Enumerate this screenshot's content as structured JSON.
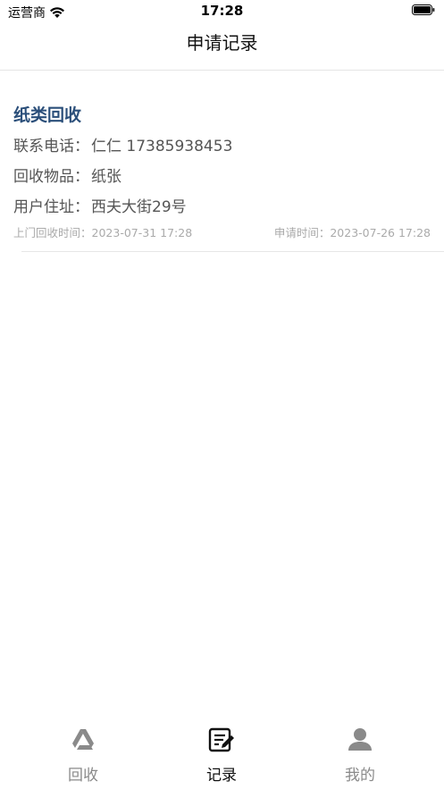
{
  "status_bar": {
    "carrier": "运营商",
    "time": "17:28"
  },
  "nav": {
    "title": "申请记录"
  },
  "records": [
    {
      "category": "纸类回收",
      "phone_label": "联系电话：",
      "phone_value": "仁仁  17385938453",
      "item_label": "回收物品：",
      "item_value": "纸张",
      "address_label": "用户住址：",
      "address_value": "西夫大街29号",
      "pickup_label": "上门回收时间：",
      "pickup_time": "2023-07-31 17:28",
      "apply_label": "申请时间：",
      "apply_time": "2023-07-26 17:28"
    }
  ],
  "tabs": [
    {
      "label": "回收",
      "icon": "recycle-icon",
      "active": false
    },
    {
      "label": "记录",
      "icon": "edit-record-icon",
      "active": true
    },
    {
      "label": "我的",
      "icon": "user-icon",
      "active": false
    }
  ],
  "colors": {
    "accent_title": "#2b4f7a",
    "tab_inactive": "#8a8a8a",
    "tab_active": "#111111"
  }
}
